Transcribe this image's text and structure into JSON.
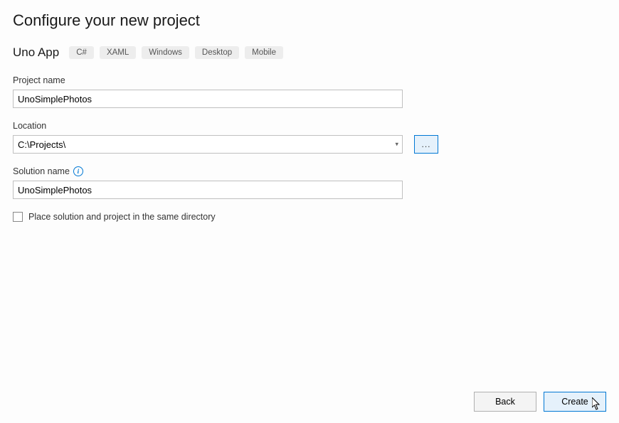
{
  "header": {
    "title": "Configure your new project",
    "templateName": "Uno App",
    "tags": [
      "C#",
      "XAML",
      "Windows",
      "Desktop",
      "Mobile"
    ]
  },
  "fields": {
    "projectName": {
      "label": "Project name",
      "value": "UnoSimplePhotos"
    },
    "location": {
      "label": "Location",
      "value": "C:\\Projects\\",
      "browseLabel": "..."
    },
    "solutionName": {
      "label": "Solution name",
      "value": "UnoSimplePhotos"
    },
    "sameDirectory": {
      "label": "Place solution and project in the same directory",
      "checked": false
    }
  },
  "footer": {
    "back": "Back",
    "create": "Create"
  }
}
